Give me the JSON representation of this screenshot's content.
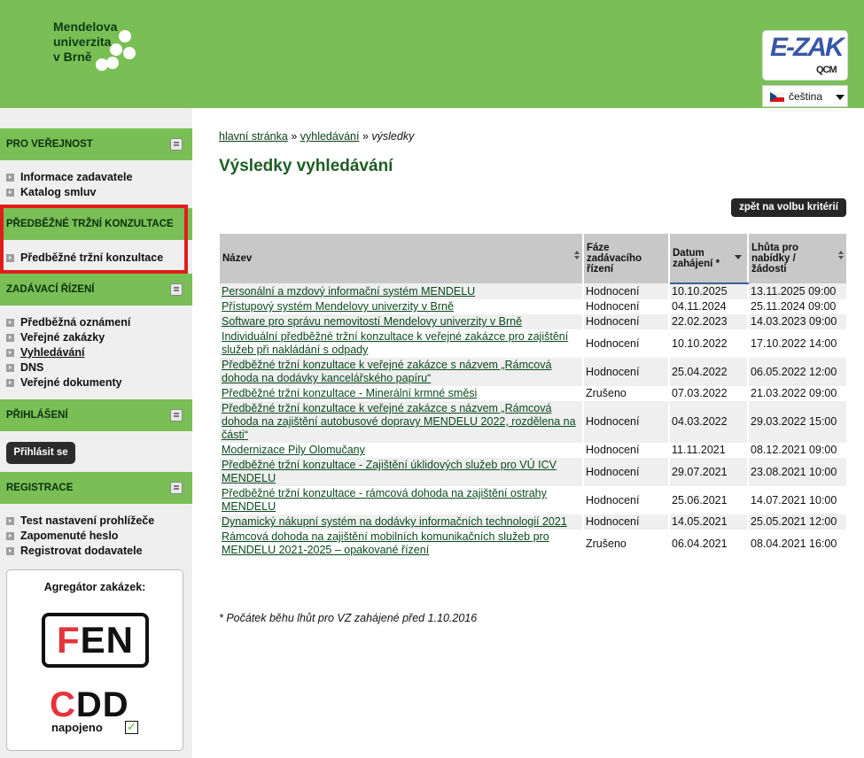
{
  "header": {
    "logo_lines": [
      "Mendelova",
      "univerzita",
      "v Brně"
    ],
    "ezak_logo": "E-ZAK",
    "ezak_sub": "QCM",
    "language": "čeština"
  },
  "sidebar": {
    "sections": [
      {
        "title": "PRO VEŘEJNOST",
        "icon": "people-icon",
        "items": [
          {
            "label": "Informace zadavatele"
          },
          {
            "label": "Katalog smluv"
          }
        ]
      },
      {
        "title": "PŘEDBĚŽNÉ TRŽNÍ KONZULTACE",
        "items": [
          {
            "label": "Předběžné tržní konzultace"
          }
        ]
      },
      {
        "title": "ZADÁVACÍ ŘÍZENÍ",
        "icon": "document-icon",
        "items": [
          {
            "label": "Předběžná oznámení"
          },
          {
            "label": "Veřejné zakázky"
          },
          {
            "label": "Vyhledávání"
          },
          {
            "label": "DNS"
          },
          {
            "label": "Veřejné dokumenty"
          }
        ]
      },
      {
        "title": "PŘIHLÁŠENÍ",
        "icon": "login-icon"
      },
      {
        "title": "REGISTRACE",
        "icon": "register-icon",
        "items": [
          {
            "label": "Test nastavení prohlížeče"
          },
          {
            "label": "Zapomenuté heslo"
          },
          {
            "label": "Registrovat dodavatele"
          }
        ]
      }
    ],
    "login_button": "Přihlásit se",
    "aggregator": {
      "title": "Agregátor zakázek:",
      "fen_f": "F",
      "fen_rest": "EN",
      "cdd_c": "C",
      "cdd_rest": "DD",
      "cdd_sub": "napojeno"
    }
  },
  "main": {
    "breadcrumb": {
      "home": "hlavní stránka",
      "sep": "»",
      "search": "vyhledávání",
      "current": "výsledky"
    },
    "title": "Výsledky vyhledávání",
    "back_button": "zpět na volbu kritérií",
    "table": {
      "columns": [
        "Název",
        "Fáze zadávacího řízení",
        "Datum zahájení *",
        "Lhůta pro nabídky / žádosti"
      ],
      "rows": [
        {
          "name": "Personální a mzdový informační systém MENDELU",
          "phase": "Hodnocení",
          "start": "10.10.2025",
          "deadline": "13.11.2025 09:00"
        },
        {
          "name": "Přístupový systém Mendelovy univerzity v Brně",
          "phase": "Hodnocení",
          "start": "04.11.2024",
          "deadline": "25.11.2024 09:00"
        },
        {
          "name": "Software pro správu nemovitostí Mendelovy univerzity v Brně",
          "phase": "Hodnocení",
          "start": "22.02.2023",
          "deadline": "14.03.2023 09:00"
        },
        {
          "name": "Individuální předběžné tržní konzultace k veřejné zakázce pro zajištění služeb při nakládání s odpady",
          "phase": "Hodnocení",
          "start": "10.10.2022",
          "deadline": "17.10.2022 14:00"
        },
        {
          "name": "Předběžné tržní konzultace k veřejné zakázce s názvem „Rámcová dohoda na dodávky kancelářského papíru“",
          "phase": "Hodnocení",
          "start": "25.04.2022",
          "deadline": "06.05.2022 12:00"
        },
        {
          "name": "Předběžné tržní konzultace - Minerální krmné směsi",
          "phase": "Zrušeno",
          "start": "07.03.2022",
          "deadline": "21.03.2022 09:00"
        },
        {
          "name": "Předběžné tržní konzultace k veřejné zakázce s názvem „Rámcová dohoda na zajištění autobusové dopravy MENDELU 2022, rozdělena na části“",
          "phase": "Hodnocení",
          "start": "04.03.2022",
          "deadline": "29.03.2022 15:00"
        },
        {
          "name": "Modernizace Pily Olomučany",
          "phase": "Hodnocení",
          "start": "11.11.2021",
          "deadline": "08.12.2021 09:00"
        },
        {
          "name": "Předběžné tržní konzultace - Zajištění úklidových služeb pro VÚ ICV MENDELU",
          "phase": "Hodnocení",
          "start": "29.07.2021",
          "deadline": "23.08.2021 10:00"
        },
        {
          "name": "Předběžné tržní konzultace - rámcová dohoda na zajištění ostrahy MENDELU",
          "phase": "Hodnocení",
          "start": "25.06.2021",
          "deadline": "14.07.2021 10:00"
        },
        {
          "name": "Dynamický nákupní systém na dodávky informačních technologií 2021",
          "phase": "Hodnocení",
          "start": "14.05.2021",
          "deadline": "25.05.2021 12:00"
        },
        {
          "name": "Rámcová dohoda na zajištění mobilních komunikačních služeb pro MENDELU 2021-2025 – opakované řízení",
          "phase": "Zrušeno",
          "start": "06.04.2021",
          "deadline": "08.04.2021 16:00"
        }
      ]
    },
    "footnote": "* Počátek běhu lhůt pro VZ zahájené před 1.10.2016"
  },
  "colors": {
    "header_green": "#79bf55",
    "title_green": "#1f5c24",
    "highlight_red": "#e21b1b"
  }
}
